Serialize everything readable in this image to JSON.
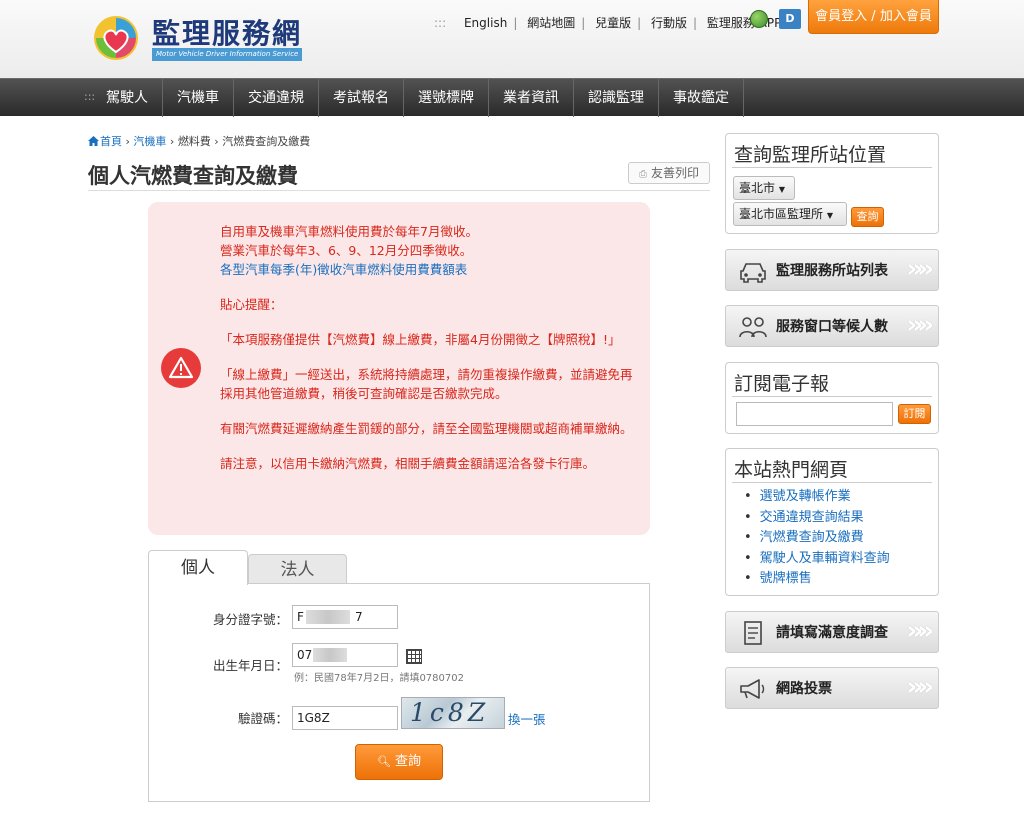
{
  "header": {
    "logo_title": "監理服務網",
    "logo_subtitle": "Motor Vehicle Driver Information Service",
    "top_links": [
      "English",
      "網站地圖",
      "兒童版",
      "行動版",
      "監理服務 APP"
    ],
    "top_links_dots": ":::",
    "db_icon_text": "D",
    "login_label": "會員登入 / 加入會員"
  },
  "nav": {
    "dots": ":::",
    "items": [
      "駕駛人",
      "汽機車",
      "交通違規",
      "考試報名",
      "選號標牌",
      "業者資訊",
      "認識監理",
      "事故鑑定"
    ]
  },
  "breadcrumb": {
    "items": [
      "首頁",
      "汽機車",
      "燃料費",
      "汽燃費查詢及繳費"
    ],
    "separator": " › "
  },
  "page": {
    "title": "個人汽燃費查詢及繳費",
    "print_label": "友善列印"
  },
  "notice": {
    "line1": "自用車及機車汽車燃料使用費於每年7月徵收。",
    "line2": "營業汽車於每年3、6、9、12月分四季徵收。",
    "link": "各型汽車每季(年)徵收汽車燃料使用費費額表",
    "reminder_title": "貼心提醒：",
    "p1": "「本項服務僅提供【汽燃費】線上繳費，非屬4月份開徵之【牌照稅】!」",
    "p2": "「線上繳費」一經送出，系統將持續處理，請勿重複操作繳費，並請避免再採用其他管道繳費，稍後可查詢確認是否繳款完成。",
    "p3": "有關汽燃費延遲繳納產生罰鍰的部分，請至全國監理機關或超商補單繳納。",
    "p4": "請注意，以信用卡繳納汽燃費，相關手續費金額請逕洽各發卡行庫。"
  },
  "tabs": [
    {
      "label": "個人",
      "active": true
    },
    {
      "label": "法人",
      "active": false
    }
  ],
  "form": {
    "id_label": "身分證字號：",
    "id_value_prefix": "F",
    "id_value_suffix": "7",
    "birth_label": "出生年月日：",
    "birth_value": "07",
    "birth_hint": "例：民國78年7月2日，請填0780702",
    "captcha_label": "驗證碼：",
    "captcha_value": "1G8Z",
    "captcha_image_text": "1c8Z",
    "refresh_label": "換一張",
    "submit_label": "查詢"
  },
  "sidebar": {
    "office_box": {
      "title": "查詢監理所站位置",
      "city": "臺北市",
      "office": "臺北市區監理所",
      "query_label": "查詢"
    },
    "btn_station_list": "監理服務所站列表",
    "btn_waiting": "服務窗口等候人數",
    "subscribe": {
      "title": "訂閱電子報",
      "email_value": "",
      "button_label": "訂閱"
    },
    "hot_pages": {
      "title": "本站熱門網頁",
      "items": [
        "選號及轉帳作業",
        "交通違規查詢結果",
        "汽燃費查詢及繳費",
        "駕駛人及車輛資料查詢",
        "號牌標售"
      ]
    },
    "btn_survey": "請填寫滿意度調查",
    "btn_vote": "網路投票",
    "chevron": "»»"
  },
  "colors": {
    "accent_orange": "#ee7a0c",
    "link_blue": "#1a6fbf",
    "notice_red": "#d9271c",
    "notice_bg": "#fbe7e7",
    "nav_dark": "#2a2a2a"
  }
}
